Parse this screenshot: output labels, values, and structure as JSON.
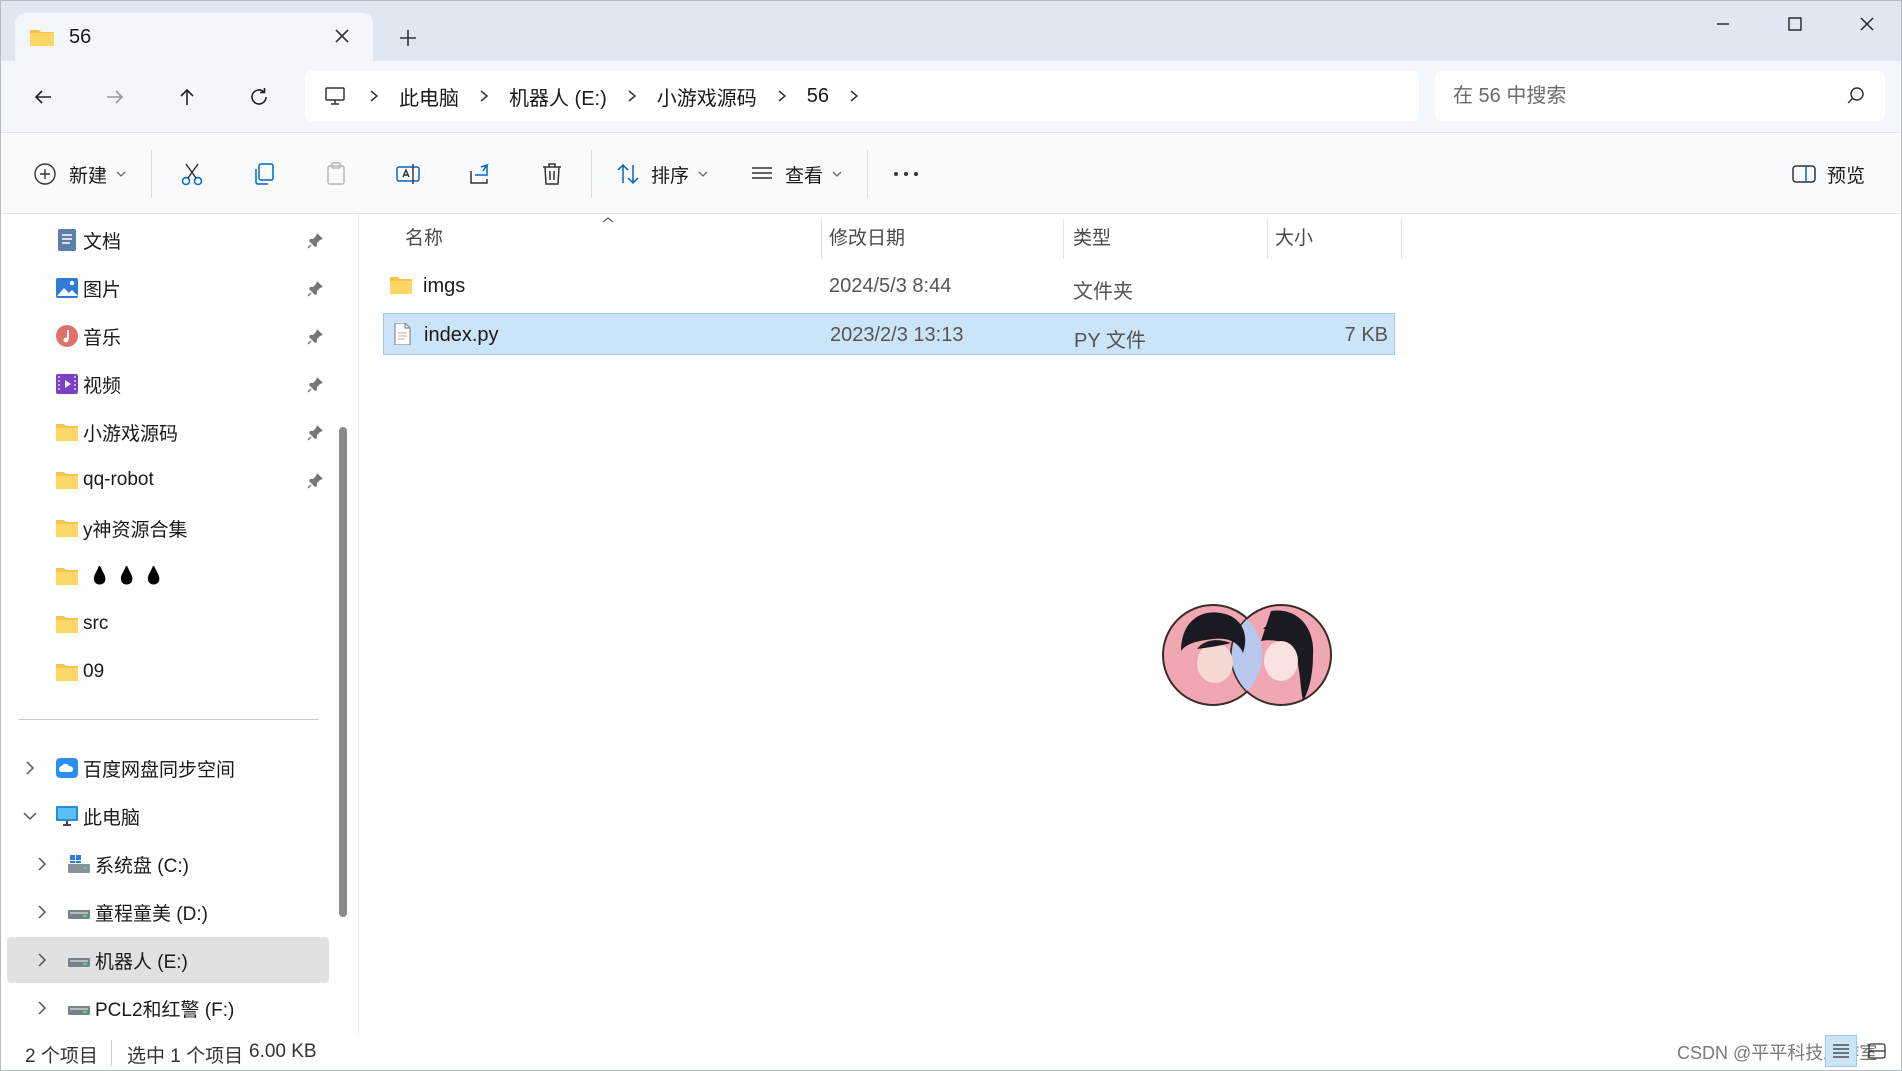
{
  "window": {
    "tab_title": "56",
    "tab_close_icon": "close-icon",
    "new_tab_icon": "plus-icon",
    "controls": [
      "minimize-icon",
      "maximize-icon",
      "close-icon"
    ]
  },
  "address_bar": {
    "nav_icons": [
      "back-arrow-icon",
      "forward-arrow-icon",
      "up-arrow-icon",
      "refresh-icon"
    ],
    "breadcrumb": [
      "此电脑",
      "机器人 (E:)",
      "小游戏源码",
      "56"
    ],
    "search_placeholder": "在 56 中搜索"
  },
  "toolbar": {
    "new_label": "新建",
    "sort_label": "排序",
    "view_label": "查看",
    "preview_label": "预览",
    "icons": [
      "cut-icon",
      "copy-icon",
      "paste-icon",
      "rename-icon",
      "share-icon",
      "delete-icon",
      "more-icon"
    ]
  },
  "sidebar": {
    "quick_access": [
      {
        "label": "文档",
        "icon": "documents-icon",
        "pinned": true
      },
      {
        "label": "图片",
        "icon": "pictures-icon",
        "pinned": true
      },
      {
        "label": "音乐",
        "icon": "music-icon",
        "pinned": true
      },
      {
        "label": "视频",
        "icon": "videos-icon",
        "pinned": true
      },
      {
        "label": "小游戏源码",
        "icon": "folder-icon",
        "pinned": true
      },
      {
        "label": "qq-robot",
        "icon": "folder-icon",
        "pinned": true
      },
      {
        "label": "y神资源合集",
        "icon": "folder-icon",
        "pinned": false
      },
      {
        "label": "💧💧💧",
        "icon": "folder-icon",
        "pinned": false
      },
      {
        "label": "src",
        "icon": "folder-icon",
        "pinned": false
      },
      {
        "label": "09",
        "icon": "folder-icon",
        "pinned": false
      }
    ],
    "cloud": {
      "label": "百度网盘同步空间",
      "icon": "baidu-cloud-icon"
    },
    "this_pc": {
      "label": "此电脑",
      "icon": "computer-icon"
    },
    "drives": [
      {
        "label": "系统盘 (C:)",
        "icon": "windows-drive-icon"
      },
      {
        "label": "童程童美 (D:)",
        "icon": "drive-icon"
      },
      {
        "label": "机器人 (E:)",
        "icon": "drive-icon"
      },
      {
        "label": "PCL2和红警 (F:)",
        "icon": "drive-icon"
      }
    ]
  },
  "file_list": {
    "columns": [
      "名称",
      "修改日期",
      "类型",
      "大小"
    ],
    "rows": [
      {
        "name": "imgs",
        "date": "2024/5/3 8:44",
        "type": "文件夹",
        "size": "",
        "icon": "folder-icon"
      },
      {
        "name": "index.py",
        "date": "2023/2/3 13:13",
        "type": "PY 文件",
        "size": "7 KB",
        "icon": "file-icon"
      }
    ]
  },
  "status_bar": {
    "item_count": "2 个项目",
    "selection": "选中 1 个项目",
    "selection_size": "6.00 KB",
    "watermark": "CSDN @平平科技工作室"
  },
  "colors": {
    "accent": "#0067c0",
    "selection_bg": "#cce4f7",
    "folder": "#f4c34a"
  }
}
